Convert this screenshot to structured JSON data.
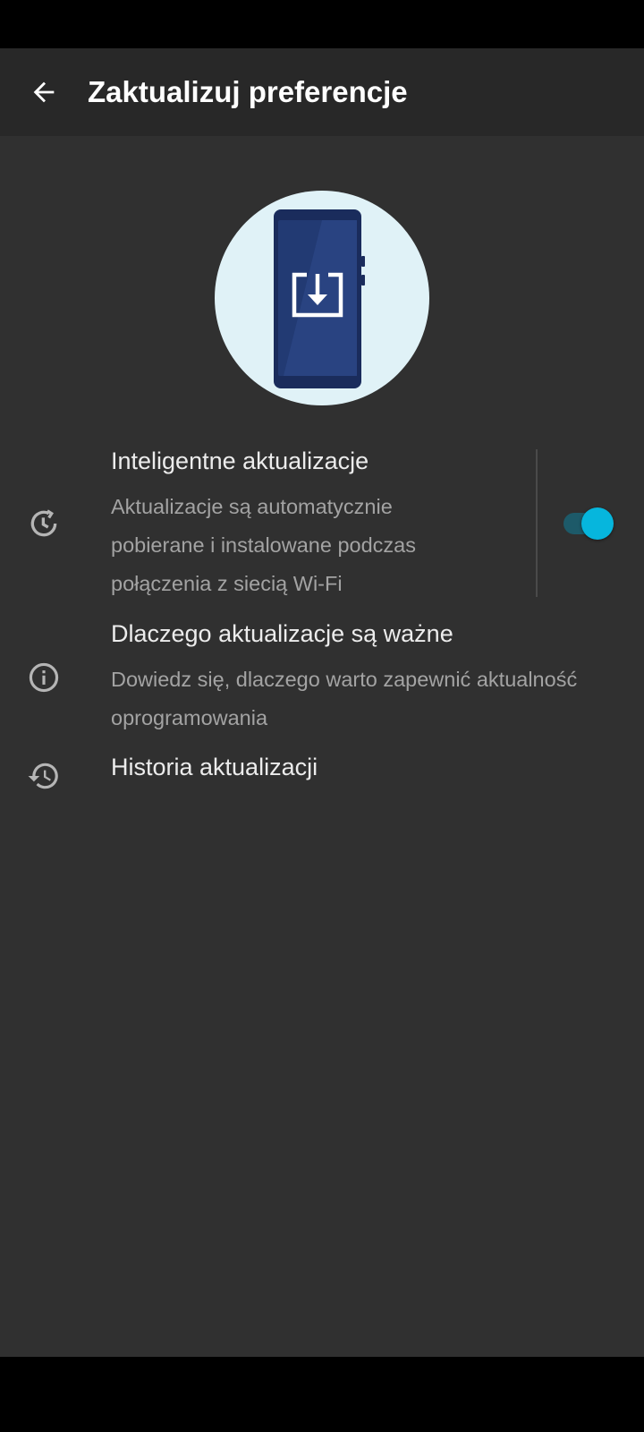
{
  "app_bar": {
    "title": "Zaktualizuj preferencje",
    "back_icon": "arrow-back-icon"
  },
  "hero": {
    "icon": "phone-download-illustration",
    "circle_color": "#e0f2f7",
    "phone_color": "#1e3466"
  },
  "preferences": [
    {
      "icon": "smart-update-clock-icon",
      "title": "Inteligentne aktualizacje",
      "summary_lines": [
        "Aktualizacje są automatycznie",
        "pobierane i instalowane podczas",
        "połączenia z siecią Wi-Fi"
      ],
      "toggle_on": true
    },
    {
      "icon": "info-icon",
      "title": "Dlaczego aktualizacje są ważne",
      "summary_lines": [
        "Dowiedz się, dlaczego warto zapewnić aktualność",
        "oprogramowania"
      ]
    },
    {
      "icon": "history-icon",
      "title": "Historia aktualizacji"
    }
  ],
  "colors": {
    "background": "#303030",
    "app_bar": "#282828",
    "accent": "#06b6dd",
    "toggle_track": "#1d5a69",
    "title_text": "#ececec",
    "summary_text": "#a3a3a3"
  }
}
